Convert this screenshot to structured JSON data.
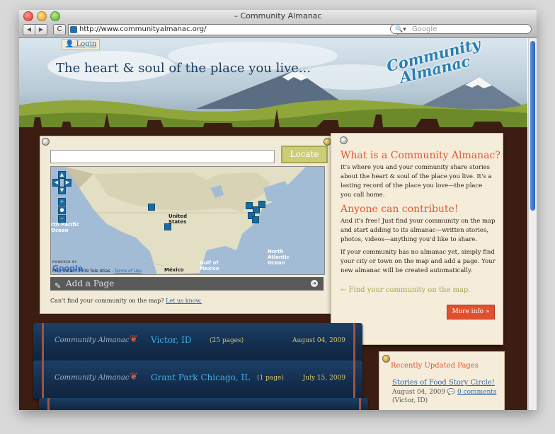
{
  "window": {
    "title": "– Community Almanac"
  },
  "toolbar": {
    "back_label": "◀",
    "forward_label": "▶",
    "reload_label": "C",
    "url": "http://www.communityalmanac.org/",
    "search_placeholder": "Google"
  },
  "header": {
    "login_label": "Login",
    "tagline": "The heart & soul of the place you live...",
    "logo_line1": "Community",
    "logo_line2": "Almanac"
  },
  "search": {
    "placeholder": "",
    "locate_label": "Locate"
  },
  "map": {
    "labels": {
      "us_line1": "United",
      "us_line2": "States",
      "pacific1": "rth Pacific",
      "pacific2": "Ocean",
      "atlantic1": "North",
      "atlantic2": "Atlantic",
      "atlantic3": "Ocean",
      "gulf1": "Gulf of",
      "gulf2": "Mexico",
      "mexico": "México"
    },
    "powered_by": "POWERED BY",
    "google_label": "Google",
    "attribution": "Map data ©2009 Tele Atlas - ",
    "terms_label": "Terms of Use",
    "controls": [
      "up-icon",
      "left-icon",
      "right-icon",
      "down-icon",
      "zoom-in-icon",
      "zoom-slider-icon",
      "zoom-out-icon"
    ],
    "add_page_label": "Add a Page",
    "cant_find_text": "Can't find your community on the map?",
    "let_us_know_label": "Let us know."
  },
  "info": {
    "heading1": "What is a Community Almanac?",
    "para1": "It's where you and your community share stories about the heart & soul of the place you live. It's a lasting record of the place you love—the place you call home.",
    "heading2": "Anyone can contribute!",
    "para2": "And it's free! Just find your community on the map and start adding to its almanac—written stories, photos, videos—anything you'd like to share.",
    "para3": "If your community has no almanac yet, simply find your city or town on the map and add a page. Your new almanac will be created automatically.",
    "find_label": "← Find your community on the map.",
    "more_info_label": "More info »"
  },
  "almanacs": [
    {
      "brand": "Community Almanac",
      "place": "Victor, ID",
      "count": "(25 pages)",
      "date": "August 04, 2009"
    },
    {
      "brand": "Community Almanac",
      "place": "Grant Park Chicago, IL",
      "count": "(1 page)",
      "date": "July 15, 2009"
    }
  ],
  "recent": {
    "heading": "Recently Updated Pages",
    "story_title": "Stories of Food Story Circle!",
    "story_date": "August 04, 2009",
    "comments_label": "0 comments",
    "story_location": "(Victor, ID)"
  },
  "colors": {
    "accent": "#e2592e",
    "link": "#2a6bb0",
    "background": "#3c1d12",
    "book": "#132d4c"
  }
}
